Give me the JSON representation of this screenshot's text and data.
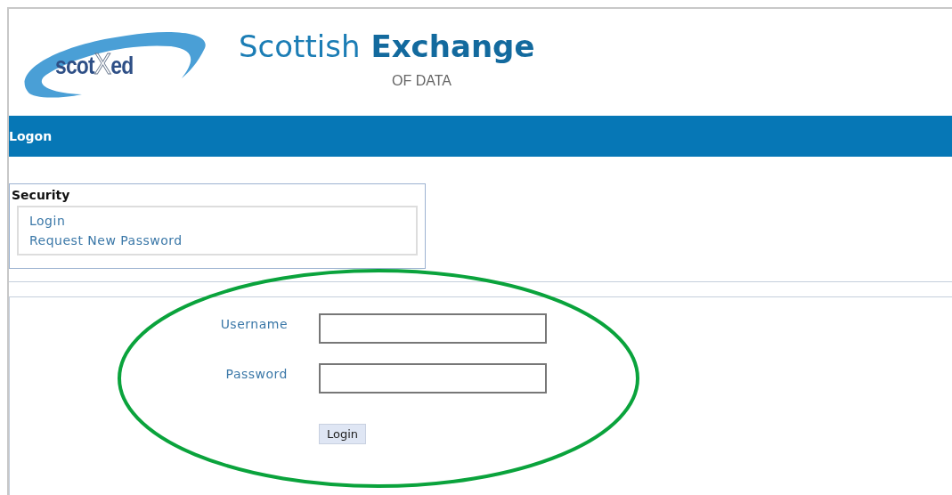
{
  "logo": {
    "parts": [
      "scot",
      "X",
      "ed"
    ]
  },
  "site_title": {
    "light": "Scottish",
    "bold": "Exchange",
    "subtitle": "OF DATA"
  },
  "page_bar": {
    "title": "Logon"
  },
  "security": {
    "title": "Security",
    "links": [
      "Login",
      "Request New Password"
    ]
  },
  "form": {
    "fields": [
      {
        "label": "Username"
      },
      {
        "label": "Password"
      }
    ],
    "submit": "Login"
  },
  "annotation": {
    "kind": "ellipse",
    "color": "#0aa33c"
  }
}
